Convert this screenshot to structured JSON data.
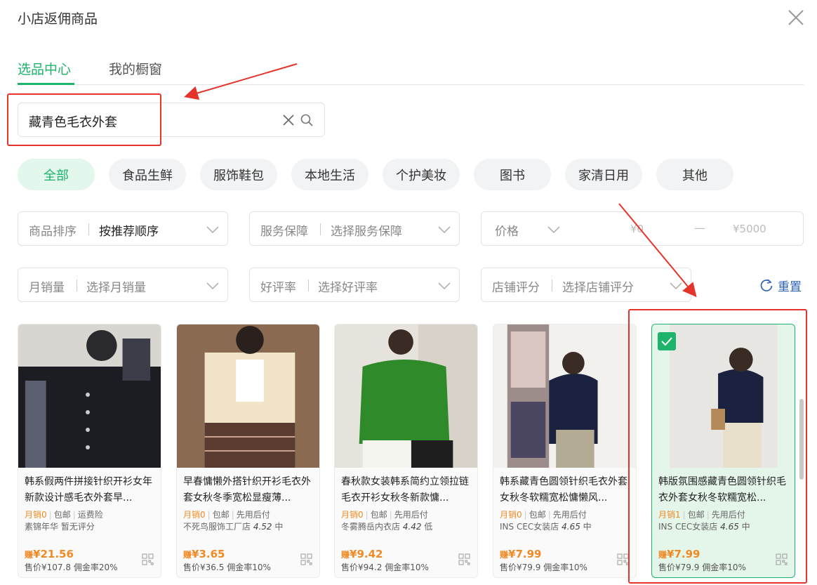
{
  "dialog": {
    "title": "小店返佣商品"
  },
  "tabs": [
    {
      "label": "选品中心",
      "active": true
    },
    {
      "label": "我的橱窗",
      "active": false
    }
  ],
  "search": {
    "value": "藏青色毛衣外套"
  },
  "categories": [
    {
      "label": "全部",
      "active": true
    },
    {
      "label": "食品生鲜"
    },
    {
      "label": "服饰鞋包"
    },
    {
      "label": "本地生活"
    },
    {
      "label": "个护美妆"
    },
    {
      "label": "图书"
    },
    {
      "label": "家清日用"
    },
    {
      "label": "其他"
    }
  ],
  "filters": {
    "sort": {
      "label": "商品排序",
      "value": "按推荐顺序"
    },
    "service": {
      "label": "服务保障",
      "value": "选择服务保障"
    },
    "price": {
      "label": "价格",
      "min_placeholder": "¥0",
      "dash": "—",
      "max_placeholder": "¥5000"
    },
    "monthly_sales": {
      "label": "月销量",
      "value": "选择月销量"
    },
    "rating": {
      "label": "好评率",
      "value": "选择好评率"
    },
    "shop_score": {
      "label": "店铺评分",
      "value": "选择店铺评分"
    },
    "reset_label": "重置"
  },
  "products": [
    {
      "title": "韩系假两件拼接针织开衫女年新款设计感毛衣外套早...",
      "sales": "月销0",
      "tags": [
        "包邮",
        "运费险"
      ],
      "shop": "素锦年华",
      "score": "",
      "score_level": "暂无评分",
      "earn": "¥21.56",
      "earn_prefix": "赚",
      "price": "售价¥107.8",
      "rate": "佣金率20%",
      "selected": false
    },
    {
      "title": "早春慵懒外搭针织开衫毛衣外套女秋冬季宽松显瘦薄...",
      "sales": "月销0",
      "tags": [
        "包邮",
        "先用后付"
      ],
      "shop": "不死鸟服饰工厂店",
      "score": "4.52",
      "score_level": "中",
      "earn": "¥3.65",
      "earn_prefix": "赚",
      "price": "售价¥36.5",
      "rate": "佣金率10%",
      "selected": false
    },
    {
      "title": "春秋款女装韩系简约立领拉链毛衣开衫女秋冬新款慵...",
      "sales": "月销0",
      "tags": [
        "包邮",
        "先用后付"
      ],
      "shop": "冬雾腾岳内衣店",
      "score": "4.42",
      "score_level": "低",
      "earn": "¥9.42",
      "earn_prefix": "赚",
      "price": "售价¥94.2",
      "rate": "佣金率10%",
      "selected": false
    },
    {
      "title": "韩系藏青色圆领针织毛衣外套女秋冬软糯宽松慵懒风...",
      "sales": "月销0",
      "tags": [
        "包邮",
        "先用后付"
      ],
      "shop": "INS CEC女装店",
      "score": "4.65",
      "score_level": "中",
      "earn": "¥7.99",
      "earn_prefix": "赚",
      "price": "售价¥79.9",
      "rate": "佣金率10%",
      "selected": false
    },
    {
      "title": "韩版氛围感藏青色圆领针织毛衣外套女秋冬软糯宽松...",
      "sales": "月销1",
      "tags": [
        "包邮",
        "先用后付"
      ],
      "shop": "INS CEC女装店",
      "score": "4.65",
      "score_level": "中",
      "earn": "¥7.99",
      "earn_prefix": "赚",
      "price": "售价¥79.9",
      "rate": "佣金率10%",
      "selected": true
    }
  ],
  "colors": {
    "accent": "#1db36b",
    "accent_light": "#e3f7ec",
    "earn_orange": "#f08a24",
    "link_blue": "#2d62b6",
    "annotation_red": "#e5342c"
  },
  "icons": [
    "close-icon",
    "clear-icon",
    "search-icon",
    "chevron-down-icon",
    "refresh-icon",
    "qr-code-icon",
    "checkmark-icon"
  ]
}
